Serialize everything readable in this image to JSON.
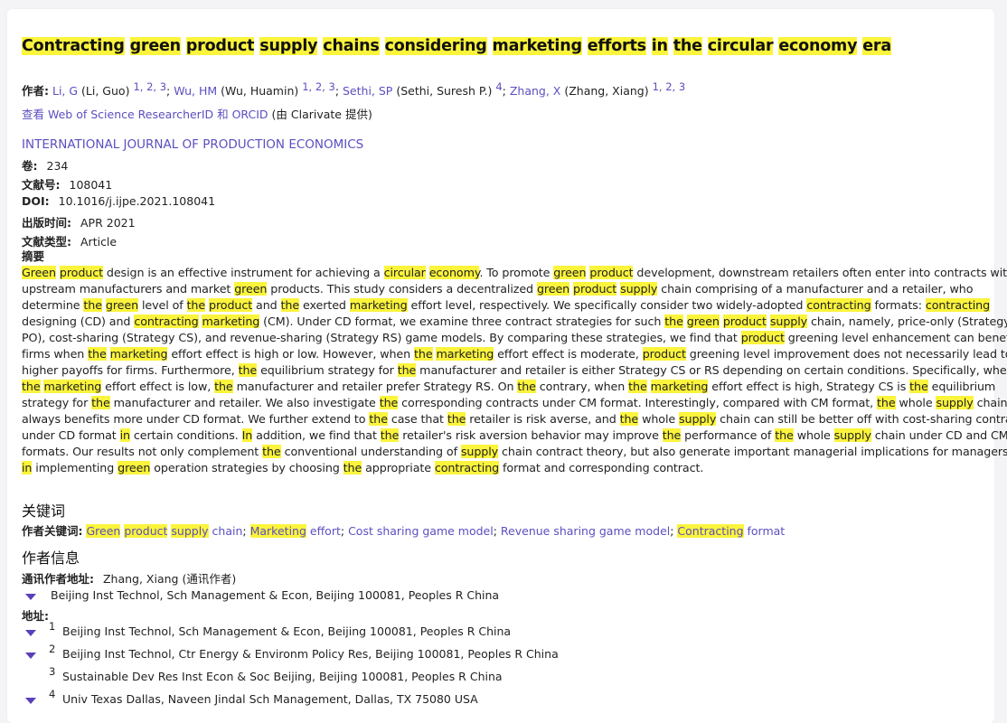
{
  "title_segments": [
    {
      "t": "Contracting",
      "h": true
    },
    {
      "t": " ",
      "h": false
    },
    {
      "t": "green",
      "h": true
    },
    {
      "t": " ",
      "h": false
    },
    {
      "t": "product",
      "h": true
    },
    {
      "t": " ",
      "h": false
    },
    {
      "t": "supply",
      "h": true
    },
    {
      "t": " ",
      "h": false
    },
    {
      "t": "chains",
      "h": true
    },
    {
      "t": " ",
      "h": false
    },
    {
      "t": "considering",
      "h": true
    },
    {
      "t": " ",
      "h": false
    },
    {
      "t": "marketing",
      "h": true
    },
    {
      "t": " ",
      "h": false
    },
    {
      "t": "efforts",
      "h": true
    },
    {
      "t": " ",
      "h": false
    },
    {
      "t": "in",
      "h": true
    },
    {
      "t": " ",
      "h": false
    },
    {
      "t": "the",
      "h": true
    },
    {
      "t": " ",
      "h": false
    },
    {
      "t": "circular",
      "h": true
    },
    {
      "t": " ",
      "h": false
    },
    {
      "t": "economy",
      "h": true
    },
    {
      "t": " ",
      "h": false
    },
    {
      "t": "era",
      "h": true
    }
  ],
  "authors": {
    "label": "作者:",
    "list": [
      {
        "short": "Li, G",
        "full": "(Li, Guo)",
        "sup": "1, 2, 3"
      },
      {
        "short": "Wu, HM",
        "full": "(Wu, Huamin)",
        "sup": "1, 2, 3"
      },
      {
        "short": "Sethi, SP",
        "full": "(Sethi, Suresh P.)",
        "sup": "4"
      },
      {
        "short": "Zhang, X",
        "full": "(Zhang, Xiang)",
        "sup": "1, 2, 3"
      }
    ],
    "orcid_link": "查看 Web of Science ResearcherID 和 ORCID",
    "orcid_note": "(由 Clarivate 提供)"
  },
  "journal": "INTERNATIONAL JOURNAL OF PRODUCTION ECONOMICS",
  "meta": [
    {
      "label": "卷:",
      "value": "234"
    },
    {
      "label": "文献号:",
      "value": "108041"
    },
    {
      "label": "DOI:",
      "value": "10.1016/j.ijpe.2021.108041"
    },
    {
      "label": "出版时间:",
      "value": "APR 2021"
    },
    {
      "label": "文献类型:",
      "value": "Article"
    }
  ],
  "abstract_label": "摘要",
  "abstract_lines": [
    "[[Green]] [[product]] design is an effective instrument for achieving a [[circular]] [[economy]]. To promote [[green]] [[product]] development, downstream retailers often enter into contracts with",
    "upstream manufacturers and market [[green]] products. This study considers a decentralized [[green]] [[product]] [[supply]] chain comprising of a manufacturer and a retailer, who",
    "determine [[the]] [[green]] level of [[the]] [[product]] and [[the]] exerted [[marketing]] effort level, respectively. We specifically consider two widely-adopted [[contracting]] formats: [[contracting]]",
    "designing (CD) and [[contracting]] [[marketing]] (CM). Under CD format, we examine three contract strategies for such [[the]] [[green]] [[product]] [[supply]] chain, namely, price-only (Strategy",
    "PO), cost-sharing (Strategy CS), and revenue-sharing (Strategy RS) game models. By comparing these strategies, we find that [[product]] greening level enhancement can benefit",
    "firms when [[the]] [[marketing]] effort effect is high or low. However, when [[the]] [[marketing]] effort effect is moderate, [[product]] greening level improvement does not necessarily lead to",
    "higher payoffs for firms. Furthermore, [[the]] equilibrium strategy for [[the]] manufacturer and retailer is either Strategy CS or RS depending on certain conditions. Specifically, when",
    "[[the]] [[marketing]] effort effect is low, [[the]] manufacturer and retailer prefer Strategy RS. On [[the]] contrary, when [[the]] [[marketing]] effort effect is high, Strategy CS is [[the]] equilibrium",
    "strategy for [[the]] manufacturer and retailer. We also investigate [[the]] corresponding contracts under CM format. Interestingly, compared with CM format, [[the]] whole [[supply]] chain",
    "always benefits more under CD format. We further extend to [[the]] case that [[the]] retailer is risk averse, and [[the]] whole [[supply]] chain can still be better off with cost-sharing contract",
    "under CD format [[in]] certain conditions. [[In]] addition, we find that [[the]] retailer's risk aversion behavior may improve [[the]] performance of [[the]] whole [[supply]] chain under CD and CM",
    "formats. Our results not only complement [[the]] conventional understanding of [[supply]] chain contract theory, but also generate important managerial implications for managers",
    "[[in]] implementing [[green]] operation strategies by choosing [[the]] appropriate [[contracting]] format and corresponding contract."
  ],
  "keywords": {
    "heading": "关键词",
    "label": "作者关键词:",
    "items": [
      "[[Green]] [[product]] [[supply]] chain",
      "[[Marketing]] effort",
      "Cost sharing game model",
      "Revenue sharing game model",
      "[[Contracting]] format"
    ]
  },
  "author_info": {
    "heading": "作者信息",
    "corr_label": "通讯作者地址:",
    "corr_name": "Zhang, Xiang",
    "corr_note": "(通讯作者)",
    "corr_address": "Beijing Inst Technol, Sch Management & Econ, Beijing 100081, Peoples R China",
    "addr_label": "地址:",
    "addresses": [
      {
        "num": "1",
        "text": "Beijing Inst Technol, Sch Management & Econ, Beijing 100081, Peoples R China",
        "expandable": true
      },
      {
        "num": "2",
        "text": "Beijing Inst Technol, Ctr Energy & Environm Policy Res, Beijing 100081, Peoples R China",
        "expandable": true
      },
      {
        "num": "3",
        "text": "Sustainable Dev Res Inst Econ & Soc Beijing, Beijing 100081, Peoples R China",
        "expandable": false
      },
      {
        "num": "4",
        "text": "Univ Texas Dallas, Naveen Jindal Sch Management, Dallas, TX 75080 USA",
        "expandable": true
      }
    ]
  },
  "colors": {
    "highlight": "#fbf43c",
    "link": "#5b4fc0",
    "caret": "#5b3fb8"
  }
}
